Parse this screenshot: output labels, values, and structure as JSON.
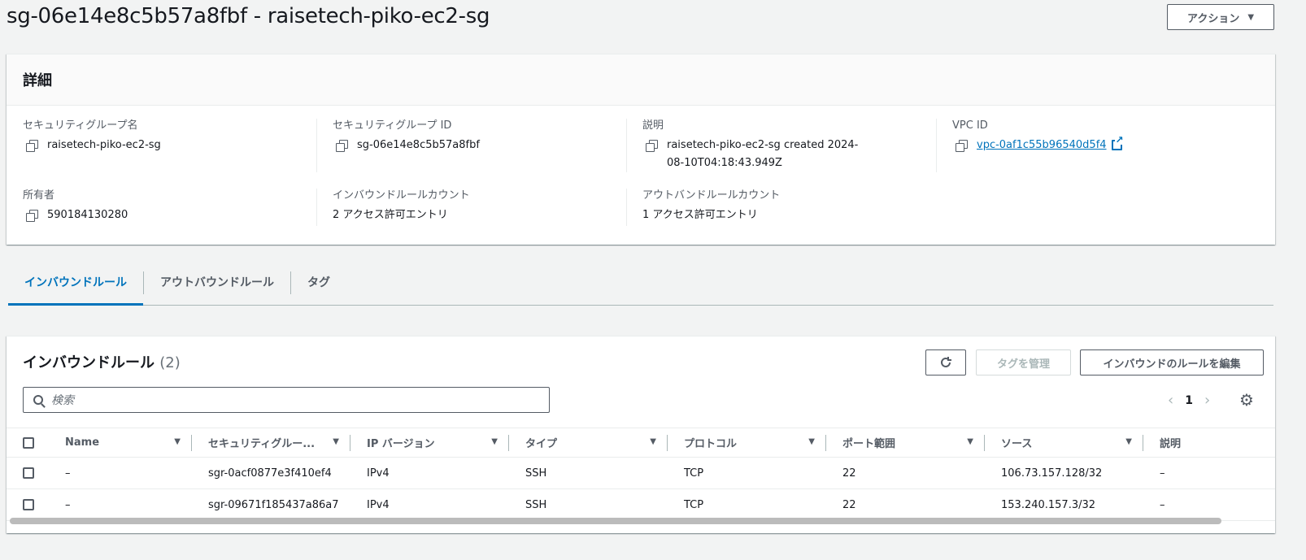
{
  "header": {
    "title": "sg-06e14e8c5b57a8fbf - raisetech-piko-ec2-sg",
    "action_label": "アクション"
  },
  "details": {
    "heading": "詳細",
    "sg_name_label": "セキュリティグループ名",
    "sg_name_value": "raisetech-piko-ec2-sg",
    "sg_id_label": "セキュリティグループ ID",
    "sg_id_value": "sg-06e14e8c5b57a8fbf",
    "description_label": "説明",
    "description_value": "raisetech-piko-ec2-sg created 2024-08-10T04:18:43.949Z",
    "vpc_label": "VPC ID",
    "vpc_value": "vpc-0af1c55b96540d5f4",
    "owner_label": "所有者",
    "owner_value": "590184130280",
    "inbound_count_label": "インバウンドルールカウント",
    "inbound_count_value": "2 アクセス許可エントリ",
    "outbound_count_label": "アウトバンドルールカウント",
    "outbound_count_value": "1 アクセス許可エントリ"
  },
  "tabs": [
    {
      "label": "インバウンドルール",
      "active": true
    },
    {
      "label": "アウトバウンドルール",
      "active": false
    },
    {
      "label": "タグ",
      "active": false
    }
  ],
  "rules": {
    "title": "インバウンドルール",
    "count": "(2)",
    "manage_tags_label": "タグを管理",
    "edit_label": "インバウンドのルールを編集",
    "search_placeholder": "検索",
    "page": "1",
    "columns": [
      "Name",
      "セキュリティグルー...",
      "IP バージョン",
      "タイプ",
      "プロトコル",
      "ポート範囲",
      "ソース",
      "説明"
    ],
    "rows": [
      [
        "–",
        "sgr-0acf0877e3f410ef4",
        "IPv4",
        "SSH",
        "TCP",
        "22",
        "106.73.157.128/32",
        "–"
      ],
      [
        "–",
        "sgr-09671f185437a86a7",
        "IPv4",
        "SSH",
        "TCP",
        "22",
        "153.240.157.3/32",
        "–"
      ]
    ]
  }
}
